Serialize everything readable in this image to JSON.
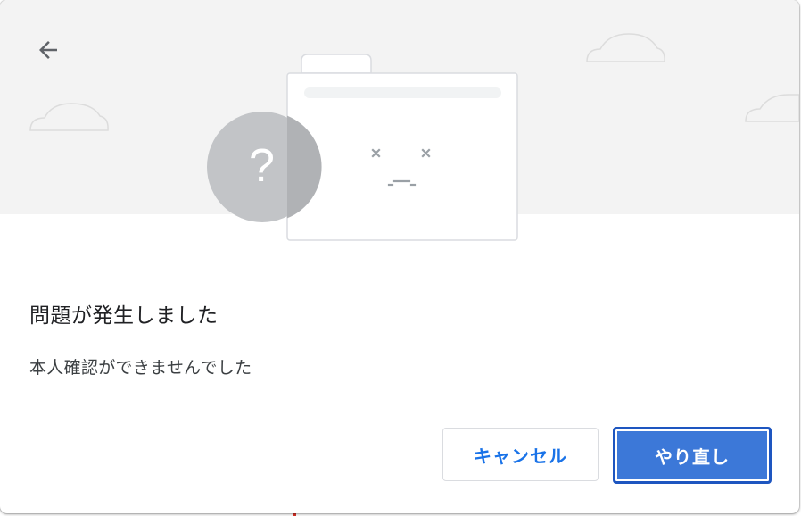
{
  "dialog": {
    "title": "問題が発生しました",
    "message": "本人確認ができませんでした"
  },
  "buttons": {
    "cancel_label": "キャンセル",
    "retry_label": "やり直し"
  },
  "illustration": {
    "question_mark": "?"
  },
  "icons": {
    "back": "arrow-left-icon"
  },
  "colors": {
    "accent": "#1a73e8",
    "primary_button": "#3c78d8",
    "hero_background": "#f3f3f3"
  }
}
